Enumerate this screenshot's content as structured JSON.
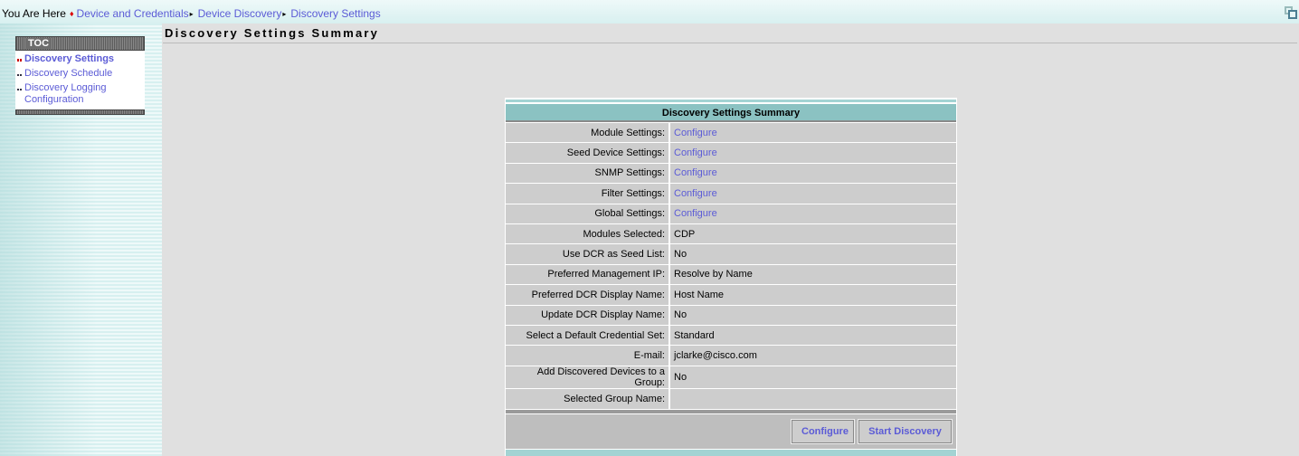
{
  "breadcrumb": {
    "prefix": "You Are Here",
    "marker": "♦",
    "separator": "▸",
    "items": [
      "Device and Credentials",
      "Device Discovery",
      "Discovery Settings"
    ]
  },
  "window_icon": "restore-window-icon",
  "toc": {
    "title": "TOC",
    "items": [
      {
        "label": "Discovery Settings",
        "active": true
      },
      {
        "label": "Discovery Schedule",
        "active": false
      },
      {
        "label": "Discovery Logging Configuration",
        "active": false
      }
    ]
  },
  "page": {
    "title": "Discovery Settings Summary"
  },
  "summary": {
    "header": "Discovery Settings Summary",
    "rows": [
      {
        "label": "Module Settings:",
        "value": "Configure",
        "link": true
      },
      {
        "label": "Seed Device Settings:",
        "value": "Configure",
        "link": true
      },
      {
        "label": "SNMP Settings:",
        "value": "Configure",
        "link": true
      },
      {
        "label": "Filter Settings:",
        "value": "Configure",
        "link": true
      },
      {
        "label": "Global Settings:",
        "value": "Configure",
        "link": true
      },
      {
        "label": "Modules Selected:",
        "value": "CDP",
        "link": false
      },
      {
        "label": "Use DCR as Seed List:",
        "value": "No",
        "link": false
      },
      {
        "label": "Preferred Management IP:",
        "value": "Resolve by Name",
        "link": false
      },
      {
        "label": "Preferred DCR Display Name:",
        "value": "Host Name",
        "link": false
      },
      {
        "label": "Update DCR Display Name:",
        "value": "No",
        "link": false
      },
      {
        "label": "Select a Default Credential Set:",
        "value": "Standard",
        "link": false
      },
      {
        "label": "E-mail:",
        "value": "jclarke@cisco.com",
        "link": false
      },
      {
        "label": "Add Discovered Devices to a Group:",
        "value": "No",
        "link": false
      },
      {
        "label": "Selected Group Name:",
        "value": "",
        "link": false
      }
    ],
    "buttons": {
      "configure": "Configure",
      "start_discovery": "Start Discovery"
    }
  }
}
